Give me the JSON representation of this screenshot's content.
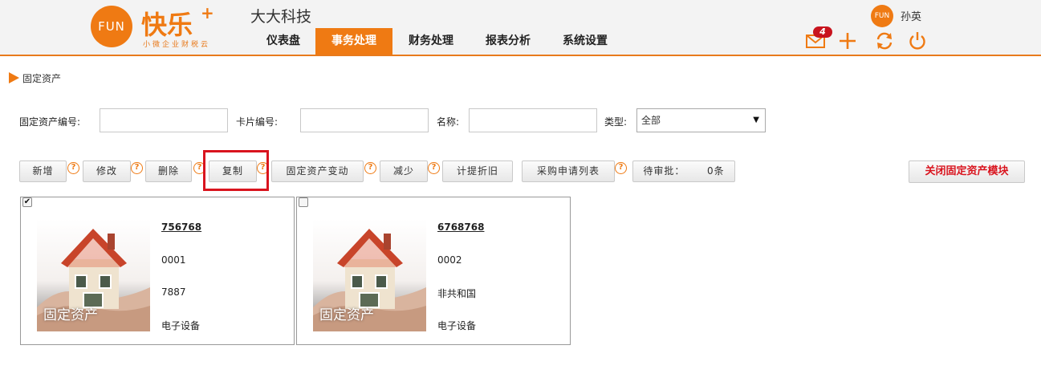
{
  "header": {
    "logo_text": "FUN",
    "brand": "快乐",
    "brand_plus": "+",
    "slogan": "小微企业财税云",
    "company": "大大科技",
    "user_avatar_text": "FUN",
    "user_name": "孙英",
    "mail_count": "4"
  },
  "nav": [
    {
      "label": "仪表盘"
    },
    {
      "label": "事务处理"
    },
    {
      "label": "财务处理"
    },
    {
      "label": "报表分析"
    },
    {
      "label": "系统设置"
    }
  ],
  "breadcrumb": "固定资产",
  "filters": {
    "asset_no_label": "固定资产编号:",
    "card_no_label": "卡片编号:",
    "name_label": "名称:",
    "type_label": "类型:",
    "type_value": "全部",
    "asset_no_value": "",
    "card_no_value": "",
    "name_value": ""
  },
  "toolbar": {
    "add": "新增",
    "edit": "修改",
    "delete": "删除",
    "copy": "复制",
    "change": "固定资产变动",
    "reduce": "减少",
    "depreciate": "计提折旧",
    "purchase_list": "采购申请列表",
    "pending": "待审批：",
    "pending_count": "0条",
    "close_module": "关闭固定资产模块",
    "help_glyph": "?"
  },
  "cards": [
    {
      "checked": true,
      "image_label": "固定资产",
      "code": "756768",
      "number": "0001",
      "field3": "7887",
      "category": "电子设备"
    },
    {
      "checked": false,
      "image_label": "固定资产",
      "code": "6768768",
      "number": "0002",
      "field3": "非共和国",
      "category": "电子设备"
    }
  ],
  "colors": {
    "accent": "#ef7a13",
    "highlight": "#d9141e"
  }
}
